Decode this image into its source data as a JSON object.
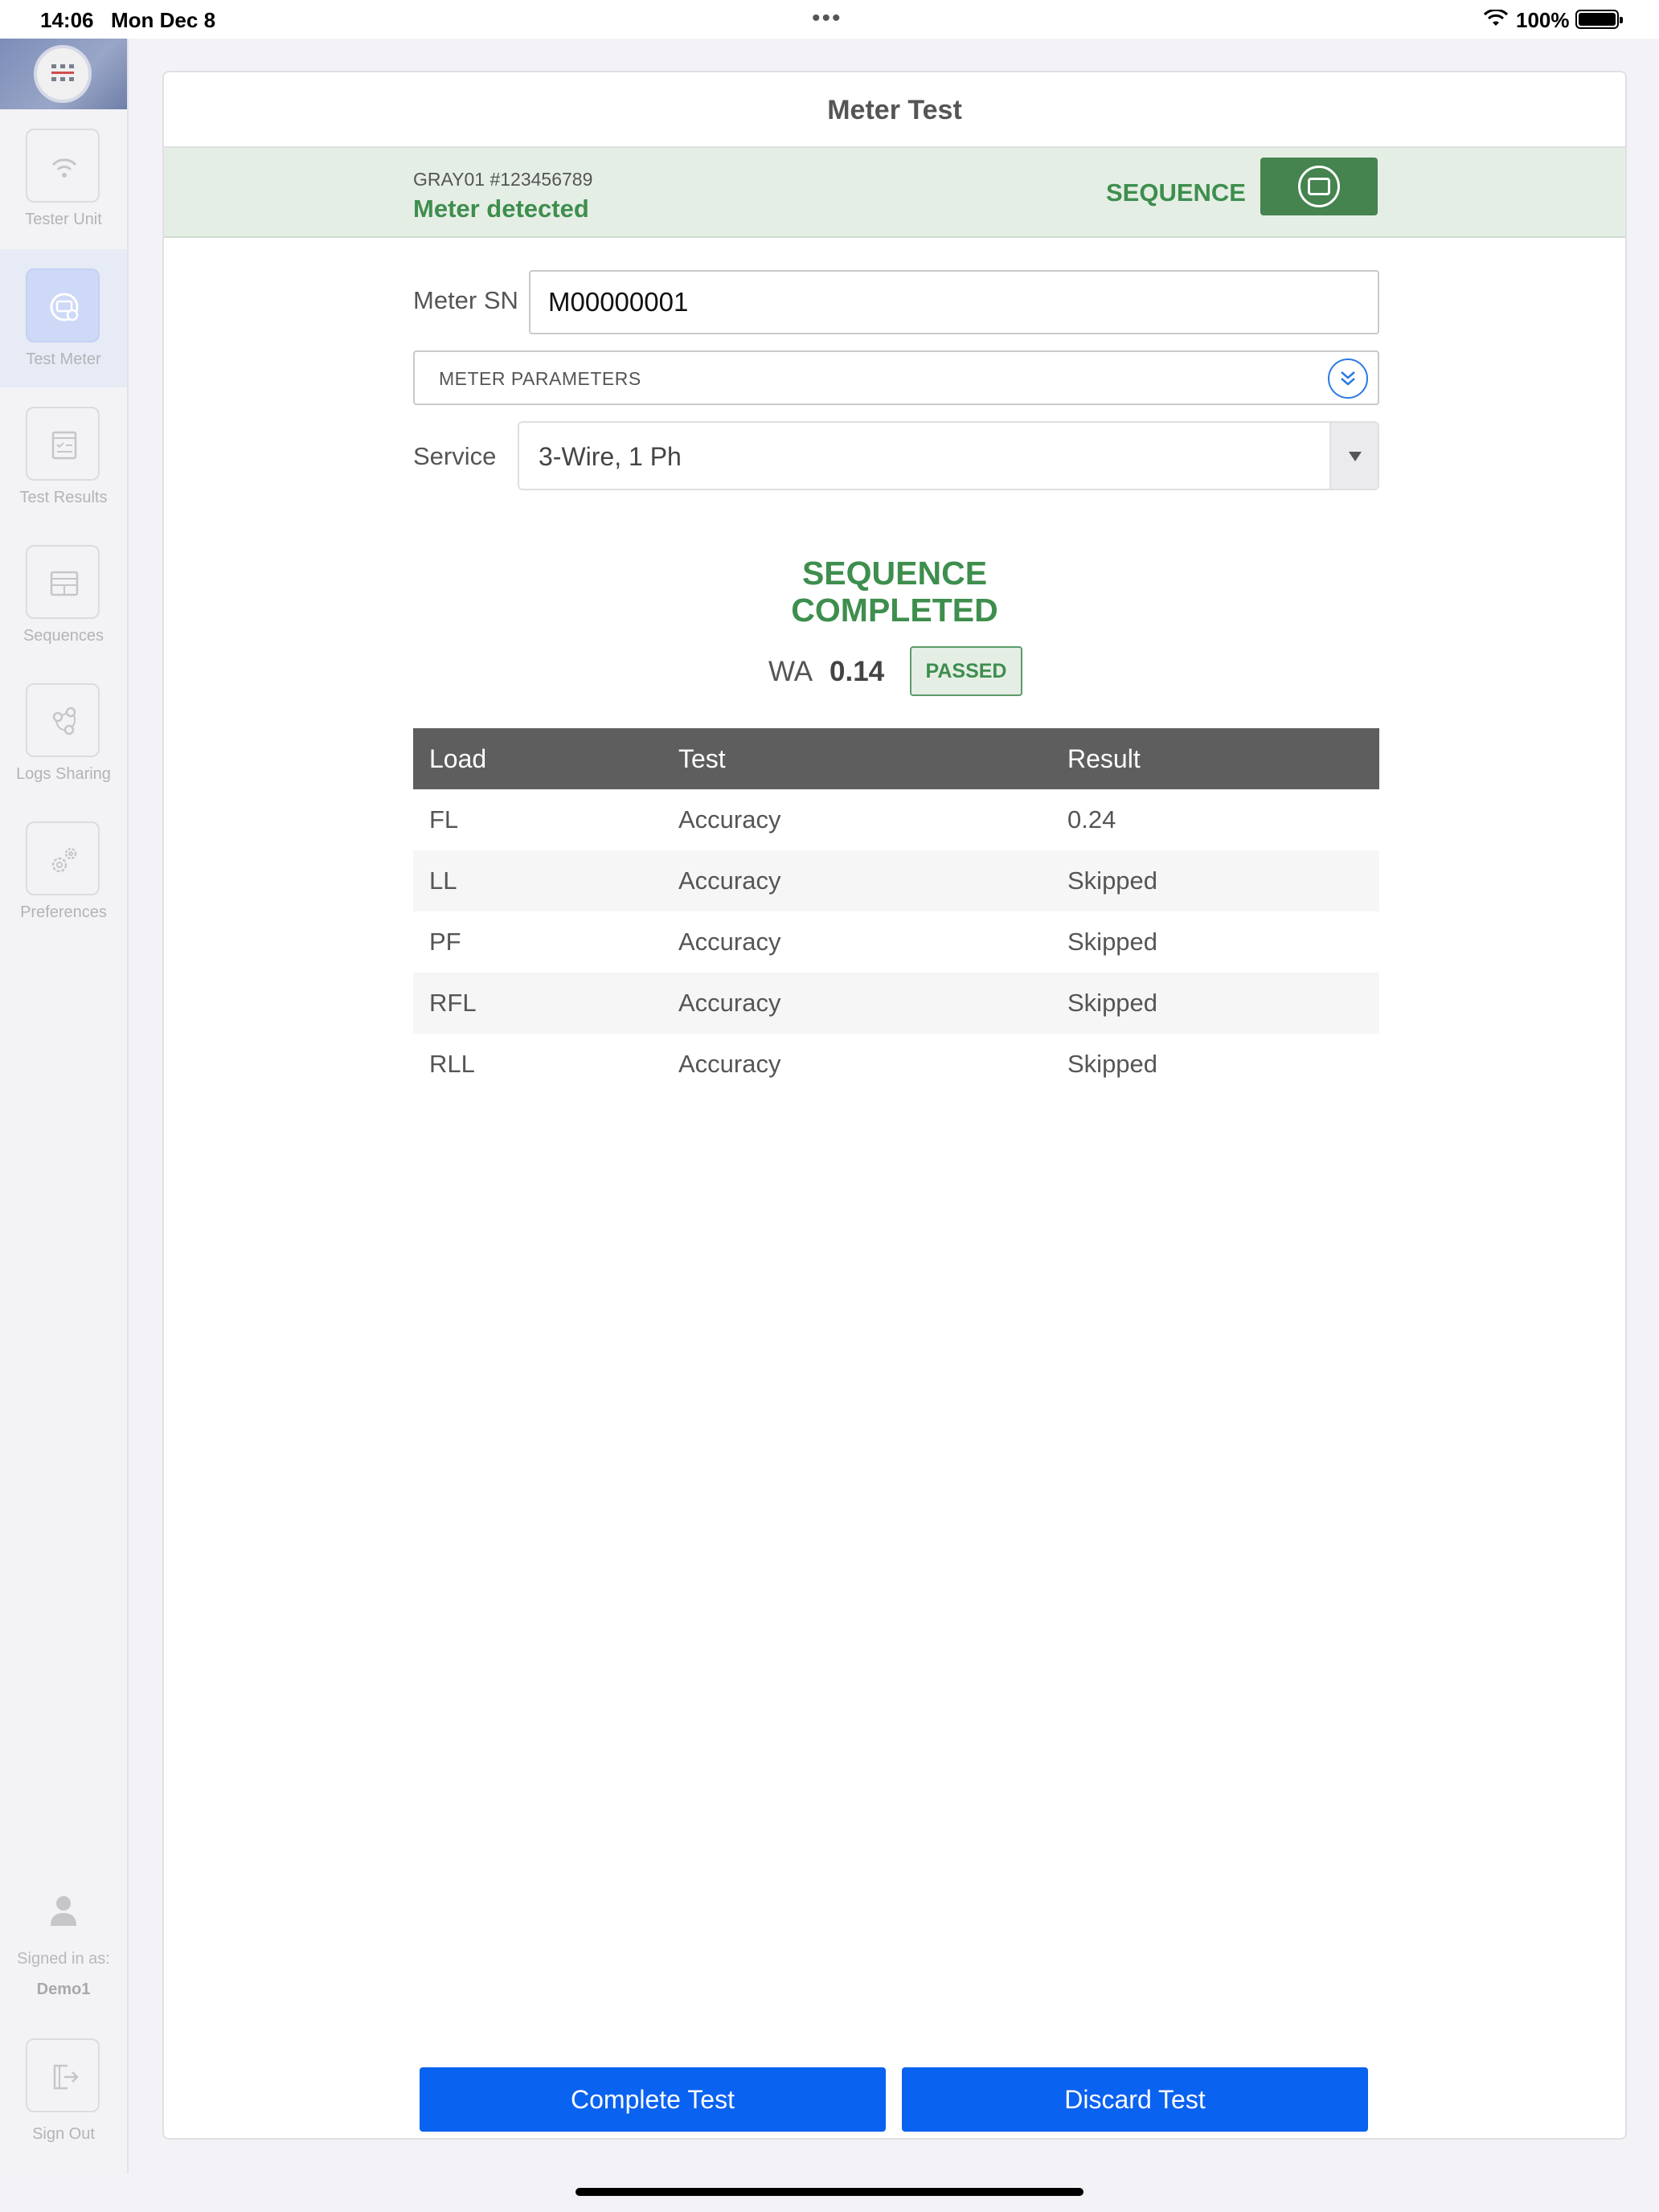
{
  "status_bar": {
    "time": "14:06",
    "date": "Mon Dec 8",
    "battery": "100%"
  },
  "sidebar": {
    "items": [
      {
        "label": "Tester Unit",
        "icon": "wifi-icon"
      },
      {
        "label": "Test Meter",
        "icon": "meter-icon",
        "active": true
      },
      {
        "label": "Test Results",
        "icon": "results-icon"
      },
      {
        "label": "Sequences",
        "icon": "sequences-icon"
      },
      {
        "label": "Logs Sharing",
        "icon": "share-icon"
      },
      {
        "label": "Preferences",
        "icon": "gear-icon"
      }
    ],
    "signed_in_label": "Signed in as:",
    "signed_in_user": "Demo1",
    "sign_out_label": "Sign Out"
  },
  "main": {
    "title": "Meter Test",
    "device_id": "GRAY01 #123456789",
    "detection_status": "Meter detected",
    "sequence_label": "SEQUENCE",
    "meter_sn_label": "Meter SN",
    "meter_sn_value": "M00000001",
    "meter_params_label": "METER PARAMETERS",
    "service_label": "Service",
    "service_value": "3-Wire, 1 Ph",
    "sequence_status_line1": "SEQUENCE",
    "sequence_status_line2": "COMPLETED",
    "wa_label": "WA",
    "wa_value": "0.14",
    "passed_label": "PASSED",
    "table": {
      "headers": [
        "Load",
        "Test",
        "Result"
      ],
      "rows": [
        [
          "FL",
          "Accuracy",
          "0.24"
        ],
        [
          "LL",
          "Accuracy",
          "Skipped"
        ],
        [
          "PF",
          "Accuracy",
          "Skipped"
        ],
        [
          "RFL",
          "Accuracy",
          "Skipped"
        ],
        [
          "RLL",
          "Accuracy",
          "Skipped"
        ]
      ]
    },
    "complete_button": "Complete Test",
    "discard_button": "Discard Test"
  },
  "colors": {
    "accent_green": "#3e8e4e",
    "button_blue": "#0a62f0",
    "table_header": "#5e5e5e"
  }
}
